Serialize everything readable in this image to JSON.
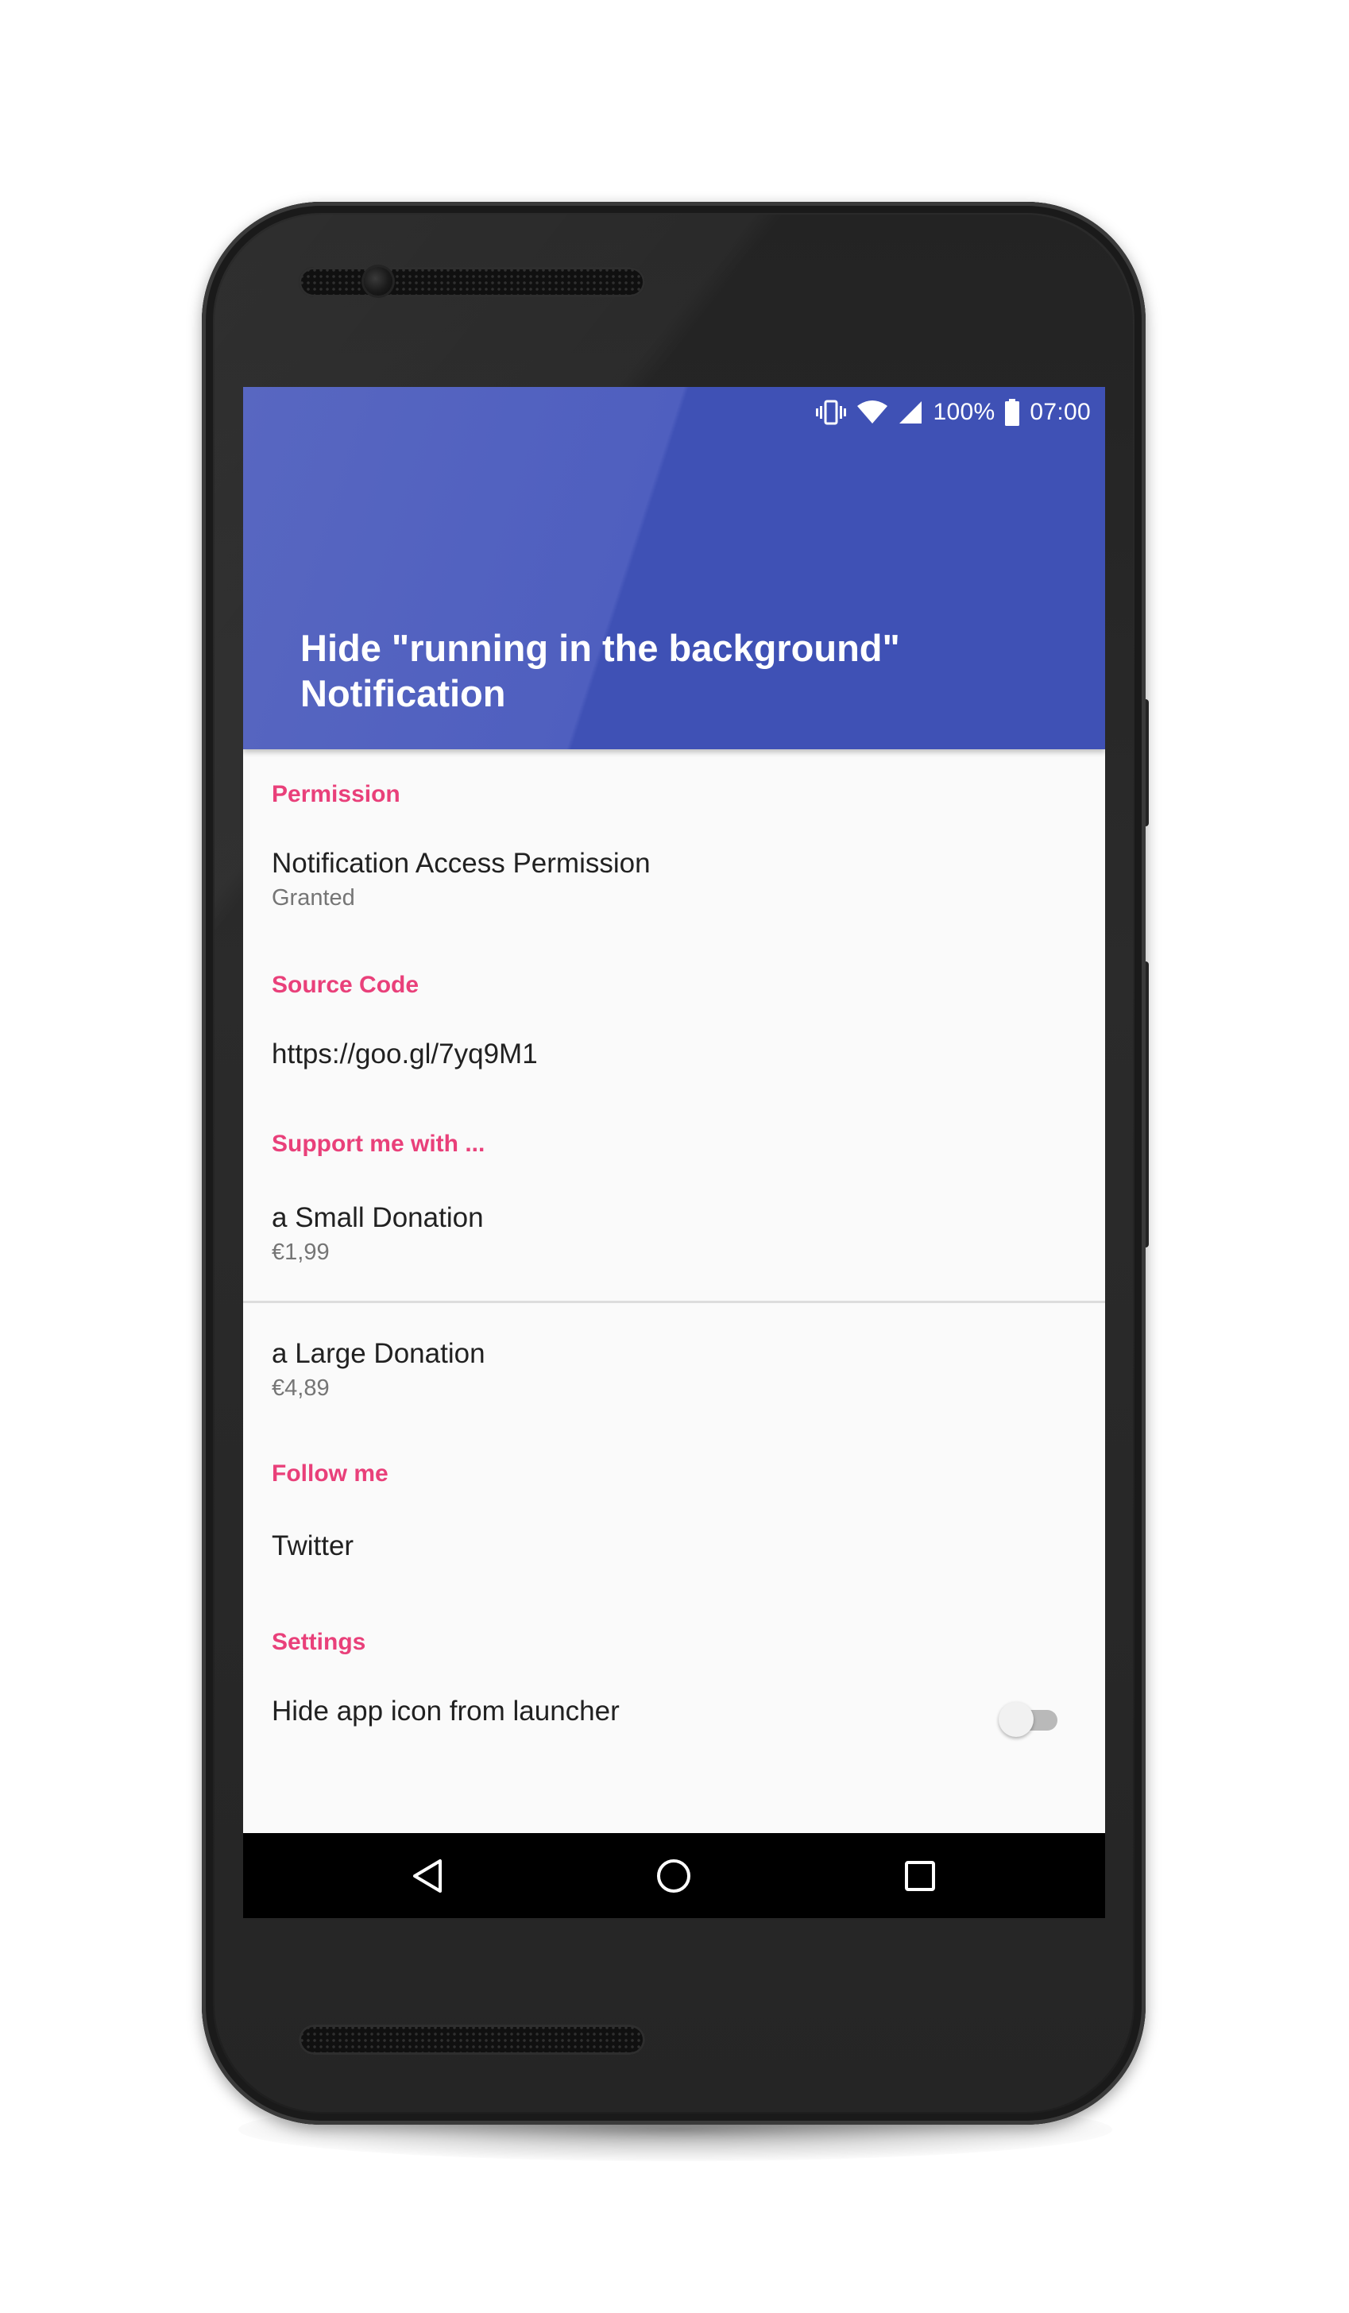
{
  "status_bar": {
    "battery": "100%",
    "time": "07:00",
    "icons": [
      "vibrate-icon",
      "wifi-icon",
      "signal-icon",
      "battery-icon"
    ]
  },
  "app_bar": {
    "title_line1": "Hide \"running in the background\"",
    "title_line2": "Notification",
    "color": "#3f51b5"
  },
  "accent_color": "#e9407a",
  "sections": {
    "permission": {
      "header": "Permission",
      "item_title": "Notification Access Permission",
      "item_summary": "Granted"
    },
    "source_code": {
      "header": "Source Code",
      "item_title": "https://goo.gl/7yq9M1"
    },
    "support": {
      "header": "Support me with ...",
      "small_title": "a Small Donation",
      "small_price": "€1,99",
      "large_title": "a Large Donation",
      "large_price": "€4,89"
    },
    "follow": {
      "header": "Follow me",
      "item_title": "Twitter"
    },
    "settings": {
      "header": "Settings",
      "item_title": "Hide app icon from launcher",
      "toggle_on": false
    }
  },
  "nav_bar": {
    "icons": [
      "back-icon",
      "home-icon",
      "recents-icon"
    ]
  }
}
